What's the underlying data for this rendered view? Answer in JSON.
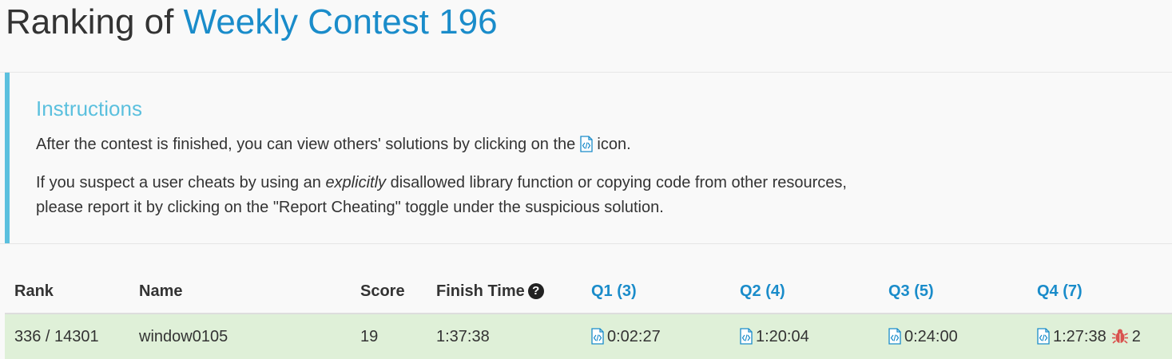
{
  "header": {
    "title_prefix": "Ranking of",
    "contest_name": "Weekly Contest 196"
  },
  "instructions": {
    "heading": "Instructions",
    "p1_before_icon": "After the contest is finished, you can view others' solutions by clicking on the",
    "p1_after_icon": "icon.",
    "p2_before_em": "If you suspect a user cheats by using an",
    "p2_em": "explicitly",
    "p2_after_em": "disallowed library function or copying code from other resources,",
    "p2_line2": "please report it by clicking on the \"Report Cheating\" toggle under the suspicious solution."
  },
  "table": {
    "columns": {
      "rank": "Rank",
      "name": "Name",
      "score": "Score",
      "finish_time": "Finish Time",
      "help_icon": "?",
      "q1": "Q1 (3)",
      "q2": "Q2 (4)",
      "q3": "Q3 (5)",
      "q4": "Q4 (7)"
    },
    "rows": [
      {
        "rank": "336 / 14301",
        "name": "window0105",
        "score": "19",
        "finish_time": "1:37:38",
        "q1": "0:02:27",
        "q2": "1:20:04",
        "q3": "0:24:00",
        "q4": "1:27:38",
        "q4_bugs": "2"
      }
    ]
  },
  "colors": {
    "accent": "#1a8cca",
    "info": "#5bc0de",
    "success_row": "#dff0d8",
    "bug": "#d9534f"
  },
  "icons": {
    "code": "code-file-icon",
    "help": "question-circle-icon",
    "bug": "bug-icon"
  }
}
